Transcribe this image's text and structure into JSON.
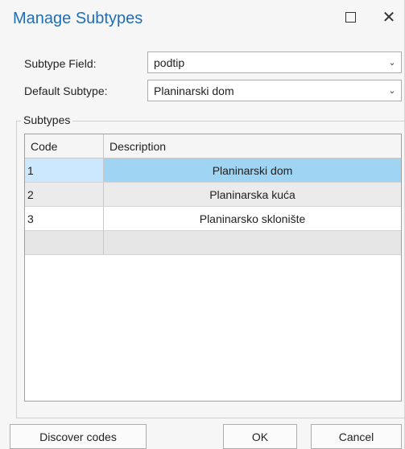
{
  "window": {
    "title": "Manage Subtypes",
    "maximize_icon": "maximize-icon",
    "close_glyph": "✕"
  },
  "form": {
    "subtype_field_label": "Subtype Field:",
    "subtype_field_value": "podtip",
    "default_subtype_label": "Default Subtype:",
    "default_subtype_value": "Planinarski dom",
    "dropdown_icon": "chevron-down-icon"
  },
  "subtypes": {
    "group_label": "Subtypes",
    "columns": [
      "Code",
      "Description"
    ],
    "rows": [
      {
        "code": "1",
        "description": "Planinarski dom"
      },
      {
        "code": "2",
        "description": "Planinarska kuća"
      },
      {
        "code": "3",
        "description": "Planinarsko sklonište"
      },
      {
        "code": "",
        "description": ""
      }
    ],
    "selected_row": 0
  },
  "buttons": {
    "discover": "Discover codes",
    "ok": "OK",
    "cancel": "Cancel"
  },
  "colors": {
    "title": "#1f6eb5",
    "selected_row": "#9fd4f2"
  }
}
